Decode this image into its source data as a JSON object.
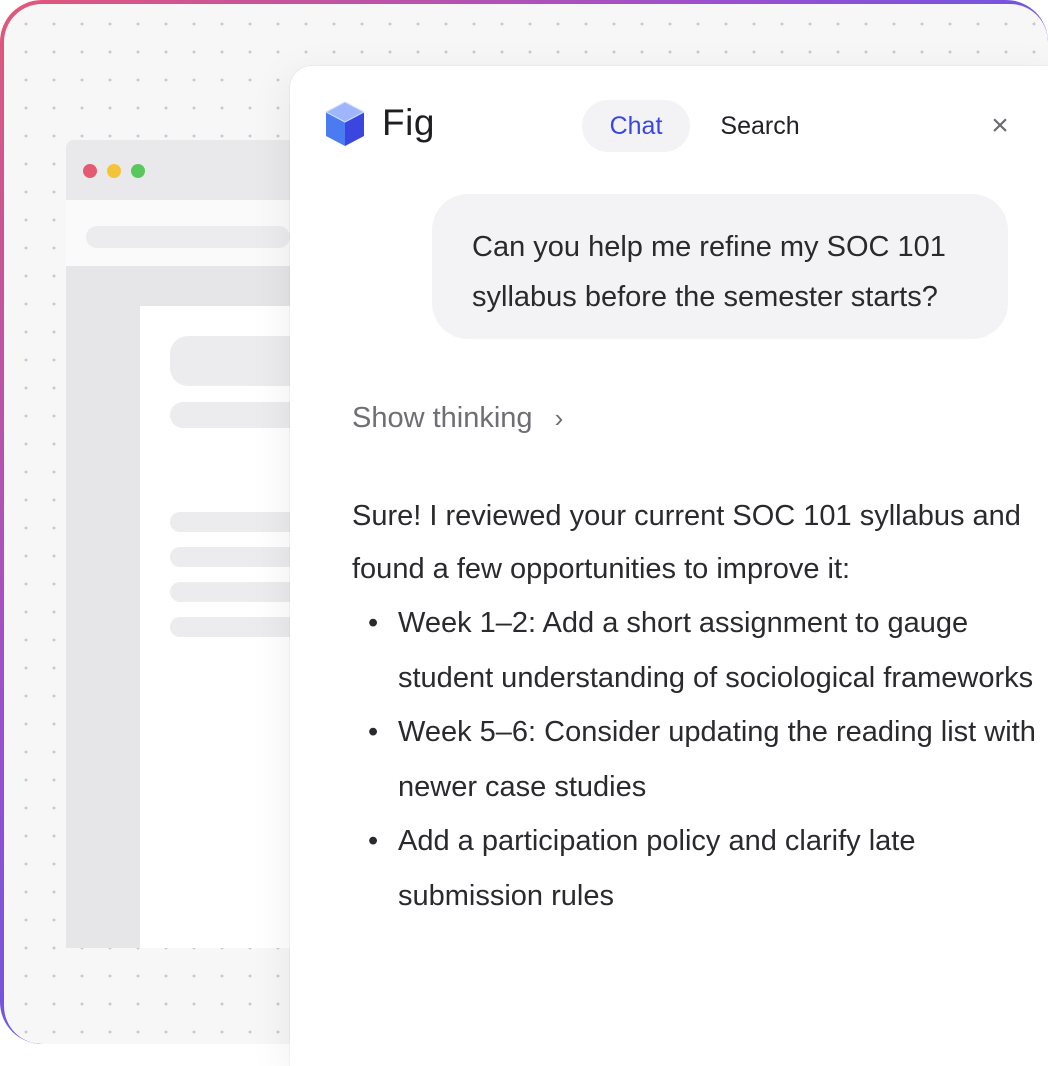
{
  "app": {
    "name": "Fig",
    "colors": {
      "accent": "#3b46e0",
      "tab_bg": "#f3f3f5"
    }
  },
  "tabs": [
    {
      "label": "Chat",
      "active": true
    },
    {
      "label": "Search",
      "active": false
    }
  ],
  "icons": {
    "logo": "cube-icon",
    "close": "close-icon",
    "chevron": "chevron-right-icon"
  },
  "close_glyph": "×",
  "chat": {
    "user_message": "Can you help me refine my SOC 101 syllabus before the semester starts?",
    "thinking_label": "Show thinking",
    "thinking_chevron": "›",
    "reply_intro": "Sure! I reviewed your current SOC 101 syllabus and found a few opportunities to improve it:",
    "reply_items": [
      "Week 1–2: Add a short assignment to gauge student understanding of sociological frameworks",
      "Week 5–6: Consider updating the reading list with newer case studies",
      "Add a participation policy and clarify late submission rules"
    ],
    "bullet": "•"
  }
}
